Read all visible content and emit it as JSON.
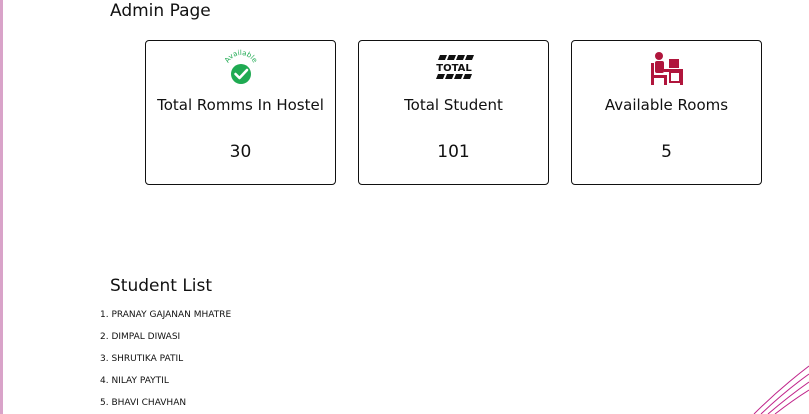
{
  "header": {
    "title": "Admin Page"
  },
  "cards": [
    {
      "icon": "available-check-icon",
      "icon_text": "Available",
      "label": "Total Romms In Hostel",
      "value": "30"
    },
    {
      "icon": "total-logo-icon",
      "icon_text": "TOTAL",
      "label": "Total Student",
      "value": "101"
    },
    {
      "icon": "student-desk-icon",
      "label": "Available Rooms",
      "value": "5"
    }
  ],
  "students": {
    "title": "Student List",
    "items": [
      "1. PRANAY GAJANAN MHATRE",
      "2. DIMPAL DIWASI",
      "3. SHRUTIKA PATIL",
      "4. NILAY PAYTIL",
      "5. BHAVI CHAVHAN"
    ]
  },
  "colors": {
    "left_accent": "#d9a3c9",
    "available_green": "#1faa52",
    "desk_icon_red": "#b0153c",
    "corner_art": "#c0248a"
  }
}
